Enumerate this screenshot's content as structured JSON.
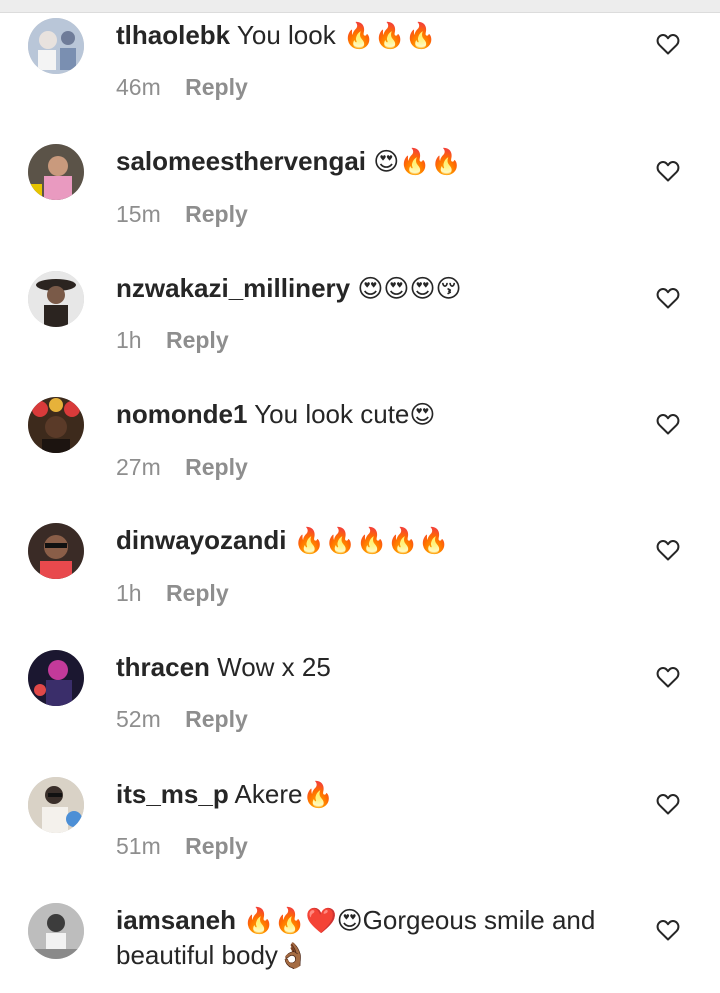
{
  "comments": [
    {
      "username": "tlhaolebk",
      "text": "You look",
      "emoji": "🔥🔥🔥",
      "time": "46m",
      "reply_label": "Reply",
      "avatar_color": "#b9c6d8",
      "avatar_accent": "#e8e2de"
    },
    {
      "username": "salomeesthervengai",
      "text": "",
      "emoji": "😍🔥🔥",
      "time": "15m",
      "reply_label": "Reply",
      "avatar_color": "#5b5348",
      "avatar_accent": "#e99ac0"
    },
    {
      "username": "nzwakazi_millinery",
      "text": "",
      "emoji": "😍😍😍😚",
      "time": "1h",
      "reply_label": "Reply",
      "avatar_color": "#e7e7e7",
      "avatar_accent": "#2b2420"
    },
    {
      "username": "nomonde1",
      "text": "You look cute",
      "emoji": "😍",
      "time": "27m",
      "reply_label": "Reply",
      "avatar_color": "#3d2a1c",
      "avatar_accent": "#d83a3a"
    },
    {
      "username": "dinwayozandi",
      "text": "",
      "emoji": "🔥🔥🔥🔥🔥",
      "time": "1h",
      "reply_label": "Reply",
      "avatar_color": "#3a2b26",
      "avatar_accent": "#e8494d"
    },
    {
      "username": "thracen",
      "text": "Wow x 25",
      "emoji": "",
      "time": "52m",
      "reply_label": "Reply",
      "avatar_color": "#1b1730",
      "avatar_accent": "#c33a9a"
    },
    {
      "username": "its_ms_p",
      "text": "Akere",
      "emoji": "🔥",
      "time": "51m",
      "reply_label": "Reply",
      "avatar_color": "#d9d2c6",
      "avatar_accent": "#3a2f2a"
    },
    {
      "username": "iamsaneh",
      "text": "Gorgeous smile and beautiful body",
      "emoji_before": "🔥🔥❤️😍",
      "emoji": "👌🏾",
      "time": "",
      "reply_label": "",
      "avatar_color": "#bdbdbd",
      "avatar_accent": "#f2f2f2"
    }
  ],
  "colors": {
    "username": "#262626",
    "meta": "#8e8e8e",
    "heart_stroke": "#262626"
  },
  "icons": {
    "like": "heart-outline-icon"
  }
}
